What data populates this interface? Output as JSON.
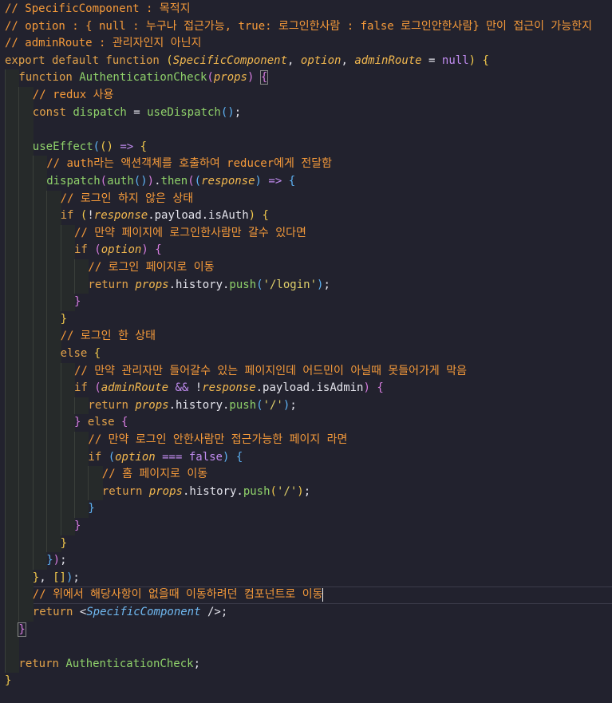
{
  "editor": {
    "lines": [
      {
        "indent": 0,
        "tokens": [
          {
            "t": "comment",
            "v": "// SpecificComponent : 목적지"
          }
        ]
      },
      {
        "indent": 0,
        "tokens": [
          {
            "t": "comment",
            "v": "// option : { null : 누구나 접근가능, true: 로그인한사람 : false 로그인안한사람} 만이 접근이 가능한지"
          }
        ]
      },
      {
        "indent": 0,
        "tokens": [
          {
            "t": "comment",
            "v": "// adminRoute : 관리자인지 아닌지"
          }
        ]
      },
      {
        "indent": 0,
        "tokens": [
          {
            "t": "kw",
            "v": "export default function "
          },
          {
            "t": "b1",
            "v": "("
          },
          {
            "t": "param",
            "v": "SpecificComponent"
          },
          {
            "t": "plain",
            "v": ", "
          },
          {
            "t": "param",
            "v": "option"
          },
          {
            "t": "plain",
            "v": ", "
          },
          {
            "t": "param",
            "v": "adminRoute"
          },
          {
            "t": "plain",
            "v": " = "
          },
          {
            "t": "const",
            "v": "null"
          },
          {
            "t": "b1",
            "v": ")"
          },
          {
            "t": "plain",
            "v": " "
          },
          {
            "t": "b1",
            "v": "{"
          }
        ]
      },
      {
        "indent": 1,
        "tokens": [
          {
            "t": "kw",
            "v": "function "
          },
          {
            "t": "fn",
            "v": "AuthenticationCheck"
          },
          {
            "t": "b2",
            "v": "("
          },
          {
            "t": "param",
            "v": "props"
          },
          {
            "t": "b2",
            "v": ")"
          },
          {
            "t": "plain",
            "v": " "
          },
          {
            "t": "b2m",
            "v": "{"
          }
        ]
      },
      {
        "indent": 2,
        "tokens": [
          {
            "t": "comment",
            "v": "// redux 사용"
          }
        ]
      },
      {
        "indent": 2,
        "tokens": [
          {
            "t": "kw",
            "v": "const "
          },
          {
            "t": "fn",
            "v": "dispatch"
          },
          {
            "t": "plain",
            "v": " = "
          },
          {
            "t": "fn",
            "v": "useDispatch"
          },
          {
            "t": "b3",
            "v": "()"
          },
          {
            "t": "plain",
            "v": ";"
          }
        ]
      },
      {
        "indent": 2,
        "tokens": []
      },
      {
        "indent": 2,
        "tokens": [
          {
            "t": "fn",
            "v": "useEffect"
          },
          {
            "t": "b3",
            "v": "("
          },
          {
            "t": "b1",
            "v": "()"
          },
          {
            "t": "const",
            "v": " => "
          },
          {
            "t": "b1",
            "v": "{"
          }
        ]
      },
      {
        "indent": 3,
        "tokens": [
          {
            "t": "comment",
            "v": "// auth라는 액션객체를 호출하여 reducer에게 전달함"
          }
        ]
      },
      {
        "indent": 3,
        "tokens": [
          {
            "t": "fn",
            "v": "dispatch"
          },
          {
            "t": "b2",
            "v": "("
          },
          {
            "t": "fn",
            "v": "auth"
          },
          {
            "t": "b3",
            "v": "()"
          },
          {
            "t": "b2",
            "v": ")"
          },
          {
            "t": "plain",
            "v": "."
          },
          {
            "t": "fn",
            "v": "then"
          },
          {
            "t": "b2",
            "v": "("
          },
          {
            "t": "b3",
            "v": "("
          },
          {
            "t": "param",
            "v": "response"
          },
          {
            "t": "b3",
            "v": ")"
          },
          {
            "t": "const",
            "v": " => "
          },
          {
            "t": "b3",
            "v": "{"
          }
        ]
      },
      {
        "indent": 4,
        "tokens": [
          {
            "t": "comment",
            "v": "// 로그인 하지 않은 상태"
          }
        ]
      },
      {
        "indent": 4,
        "tokens": [
          {
            "t": "kw",
            "v": "if "
          },
          {
            "t": "b1",
            "v": "("
          },
          {
            "t": "plain",
            "v": "!"
          },
          {
            "t": "param",
            "v": "response"
          },
          {
            "t": "plain",
            "v": ".payload.isAuth"
          },
          {
            "t": "b1",
            "v": ")"
          },
          {
            "t": "plain",
            "v": " "
          },
          {
            "t": "b1",
            "v": "{"
          }
        ]
      },
      {
        "indent": 5,
        "tokens": [
          {
            "t": "comment",
            "v": "// 만약 페이지에 로그인한사람만 갈수 있다면"
          }
        ]
      },
      {
        "indent": 5,
        "tokens": [
          {
            "t": "kw",
            "v": "if "
          },
          {
            "t": "b2",
            "v": "("
          },
          {
            "t": "param",
            "v": "option"
          },
          {
            "t": "b2",
            "v": ")"
          },
          {
            "t": "plain",
            "v": " "
          },
          {
            "t": "b2",
            "v": "{"
          }
        ]
      },
      {
        "indent": 6,
        "tokens": [
          {
            "t": "comment",
            "v": "// 로그인 페이지로 이동"
          }
        ]
      },
      {
        "indent": 6,
        "tokens": [
          {
            "t": "kw",
            "v": "return "
          },
          {
            "t": "param",
            "v": "props"
          },
          {
            "t": "plain",
            "v": ".history."
          },
          {
            "t": "fn",
            "v": "push"
          },
          {
            "t": "b3",
            "v": "("
          },
          {
            "t": "str",
            "v": "'/login'"
          },
          {
            "t": "b3",
            "v": ")"
          },
          {
            "t": "plain",
            "v": ";"
          }
        ]
      },
      {
        "indent": 5,
        "tokens": [
          {
            "t": "b2",
            "v": "}"
          }
        ]
      },
      {
        "indent": 4,
        "tokens": [
          {
            "t": "b1",
            "v": "}"
          }
        ]
      },
      {
        "indent": 4,
        "tokens": [
          {
            "t": "comment",
            "v": "// 로그인 한 상태"
          }
        ]
      },
      {
        "indent": 4,
        "tokens": [
          {
            "t": "kw",
            "v": "else "
          },
          {
            "t": "b1",
            "v": "{"
          }
        ]
      },
      {
        "indent": 5,
        "tokens": [
          {
            "t": "comment",
            "v": "// 만약 관리자만 들어갈수 있는 페이지인데 어드민이 아닐때 못들어가게 막음"
          }
        ]
      },
      {
        "indent": 5,
        "tokens": [
          {
            "t": "kw",
            "v": "if "
          },
          {
            "t": "b2",
            "v": "("
          },
          {
            "t": "param",
            "v": "adminRoute"
          },
          {
            "t": "const",
            "v": " && "
          },
          {
            "t": "plain",
            "v": "!"
          },
          {
            "t": "param",
            "v": "response"
          },
          {
            "t": "plain",
            "v": ".payload.isAdmin"
          },
          {
            "t": "b2",
            "v": ")"
          },
          {
            "t": "plain",
            "v": " "
          },
          {
            "t": "b2",
            "v": "{"
          }
        ]
      },
      {
        "indent": 6,
        "tokens": [
          {
            "t": "kw",
            "v": "return "
          },
          {
            "t": "param",
            "v": "props"
          },
          {
            "t": "plain",
            "v": ".history."
          },
          {
            "t": "fn",
            "v": "push"
          },
          {
            "t": "b3",
            "v": "("
          },
          {
            "t": "str",
            "v": "'/'"
          },
          {
            "t": "b3",
            "v": ")"
          },
          {
            "t": "plain",
            "v": ";"
          }
        ]
      },
      {
        "indent": 5,
        "tokens": [
          {
            "t": "b2",
            "v": "}"
          },
          {
            "t": "kw",
            "v": " else "
          },
          {
            "t": "b2",
            "v": "{"
          }
        ]
      },
      {
        "indent": 6,
        "tokens": [
          {
            "t": "comment",
            "v": "// 만약 로그인 안한사람만 접근가능한 페이지 라면"
          }
        ]
      },
      {
        "indent": 6,
        "tokens": [
          {
            "t": "kw",
            "v": "if "
          },
          {
            "t": "b3",
            "v": "("
          },
          {
            "t": "param",
            "v": "option"
          },
          {
            "t": "const",
            "v": " === false"
          },
          {
            "t": "b3",
            "v": ")"
          },
          {
            "t": "plain",
            "v": " "
          },
          {
            "t": "b3",
            "v": "{"
          }
        ]
      },
      {
        "indent": 7,
        "tokens": [
          {
            "t": "comment",
            "v": "// 홈 페이지로 이동"
          }
        ]
      },
      {
        "indent": 7,
        "tokens": [
          {
            "t": "kw",
            "v": "return "
          },
          {
            "t": "param",
            "v": "props"
          },
          {
            "t": "plain",
            "v": ".history."
          },
          {
            "t": "fn",
            "v": "push"
          },
          {
            "t": "b1",
            "v": "("
          },
          {
            "t": "str",
            "v": "'/'"
          },
          {
            "t": "b1",
            "v": ")"
          },
          {
            "t": "plain",
            "v": ";"
          }
        ]
      },
      {
        "indent": 6,
        "tokens": [
          {
            "t": "b3",
            "v": "}"
          }
        ]
      },
      {
        "indent": 5,
        "tokens": [
          {
            "t": "b2",
            "v": "}"
          }
        ]
      },
      {
        "indent": 4,
        "tokens": [
          {
            "t": "b1",
            "v": "}"
          }
        ]
      },
      {
        "indent": 3,
        "tokens": [
          {
            "t": "b3",
            "v": "}"
          },
          {
            "t": "b2",
            "v": ")"
          },
          {
            "t": "plain",
            "v": ";"
          }
        ]
      },
      {
        "indent": 2,
        "tokens": [
          {
            "t": "b1",
            "v": "}"
          },
          {
            "t": "plain",
            "v": ", "
          },
          {
            "t": "b1",
            "v": "[]"
          },
          {
            "t": "b3",
            "v": ")"
          },
          {
            "t": "plain",
            "v": ";"
          }
        ]
      },
      {
        "indent": 2,
        "current": true,
        "tokens": [
          {
            "t": "comment",
            "v": "// 위에서 해당사항이 없을때 이동하려던 컴포넌트로 이동"
          },
          {
            "t": "cursor",
            "v": ""
          }
        ]
      },
      {
        "indent": 2,
        "tokens": [
          {
            "t": "kw",
            "v": "return "
          },
          {
            "t": "plain",
            "v": "<"
          },
          {
            "t": "comp",
            "v": "SpecificComponent"
          },
          {
            "t": "plain",
            "v": " />;"
          }
        ]
      },
      {
        "indent": 1,
        "tokens": [
          {
            "t": "b2m",
            "v": "}"
          }
        ]
      },
      {
        "indent": 1,
        "tokens": []
      },
      {
        "indent": 1,
        "tokens": [
          {
            "t": "kw",
            "v": "return "
          },
          {
            "t": "fn",
            "v": "AuthenticationCheck"
          },
          {
            "t": "plain",
            "v": ";"
          }
        ]
      },
      {
        "indent": 0,
        "tokens": [
          {
            "t": "b1",
            "v": "}"
          }
        ]
      }
    ]
  }
}
